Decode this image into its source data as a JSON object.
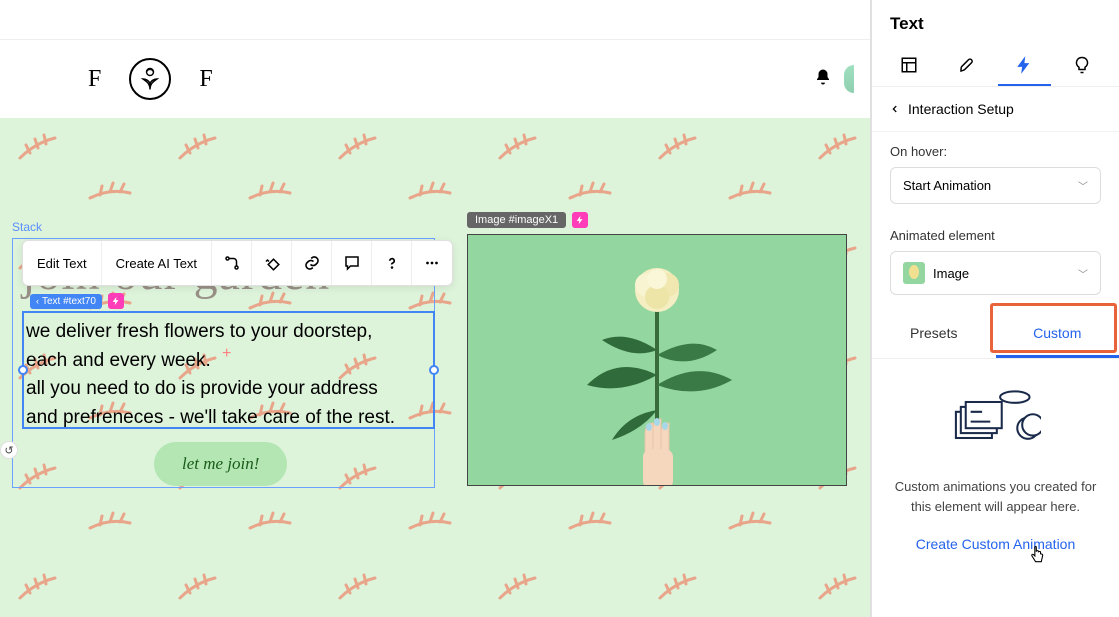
{
  "header": {
    "logo_left": "F",
    "logo_right": "F"
  },
  "canvas": {
    "stack_label": "Stack",
    "text_tag": "Text #text70",
    "image_tag": "Image #imageX1",
    "heading": "join our garden",
    "body_line1": "we deliver fresh flowers to your doorstep,",
    "body_line2": "each and every week.",
    "body_line3": "all you need to do is provide your address",
    "body_line4": "and prefreneces - we'll take care of the rest.",
    "cta": "let me join!"
  },
  "toolbar": {
    "edit_text": "Edit Text",
    "create_ai": "Create AI Text"
  },
  "sidebar": {
    "title": "Text",
    "breadcrumb": "Interaction Setup",
    "hover_label": "On hover:",
    "hover_value": "Start Animation",
    "animated_label": "Animated element",
    "animated_value": "Image",
    "presets_tab": "Presets",
    "custom_tab": "Custom",
    "empty_text": "Custom animations you created for this element will appear here.",
    "create_link": "Create Custom Animation"
  }
}
